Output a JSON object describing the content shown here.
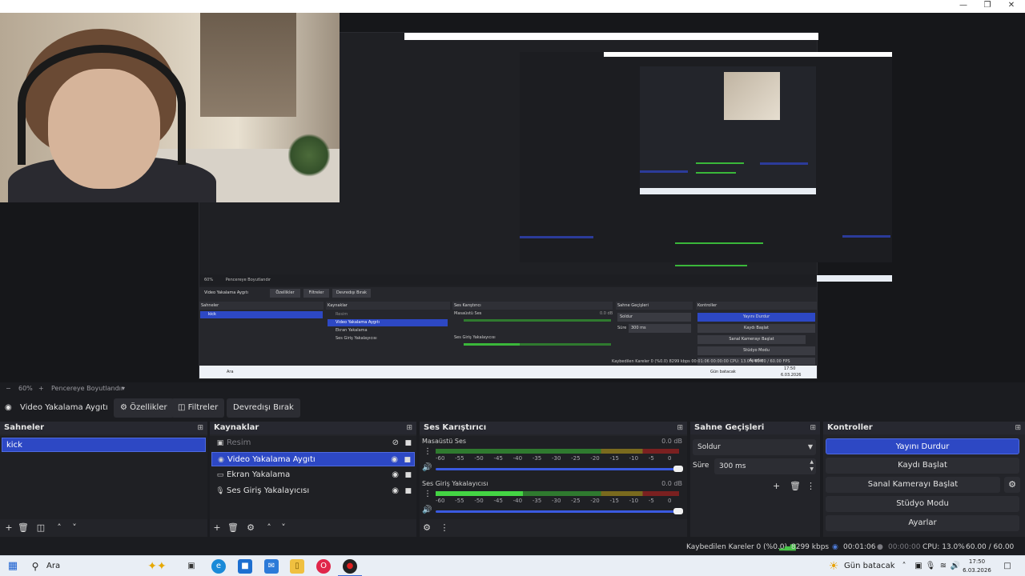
{
  "window": {
    "controls": [
      "—",
      "❐",
      "✕"
    ]
  },
  "nested_preview": {
    "zoom": "60%",
    "mode": "Pencereye Boyutlandır",
    "source_title": "Video Yakalama Aygıtı",
    "buttons": [
      "Özellikler",
      "Filtreler",
      "Devredışı Bırak"
    ],
    "scenes_header": "Sahneler",
    "scene": "kick",
    "sources_header": "Kaynaklar",
    "sources": [
      "Resim",
      "Video Yakalama Aygıtı",
      "Ekran Yakalama",
      "Ses Giriş Yakalayıcısı"
    ],
    "mixer_header": "Ses Karıştırıcı",
    "mixer_channels": [
      "Masaüstü Ses",
      "Ses Giriş Yakalayıcısı"
    ],
    "mixer_db": "0.0 dB",
    "transitions_header": "Sahne Geçişleri",
    "transition": "Soldur",
    "duration_label": "Süre",
    "duration": "300 ms",
    "controls_header": "Kontroller",
    "controls": [
      "Yayını Durdur",
      "Kaydı Başlat",
      "Sanal Kamerayı Başlat",
      "Stüdyo Modu",
      "Ayarlar"
    ],
    "status": "Kaybedilen Kareler 0 (%0.0)   8299 kbps   00:01:06   00:00:00   CPU: 13.0%   60.00 / 60.00 FPS",
    "search": "Ara",
    "weather": "Gün batacak",
    "time": "17:50",
    "date": "6.03.2026"
  },
  "zoom": {
    "minus": "−",
    "value": "60%",
    "plus": "+",
    "mode": "Pencereye Boyutlandır",
    "dropdown": "▾"
  },
  "source_bar": {
    "title": "Video Yakalama Aygıtı",
    "properties": "Özellikler",
    "filters": "Filtreler",
    "deactivate": "Devredışı Bırak"
  },
  "scenes": {
    "header": "Sahneler",
    "items": [
      "kick"
    ]
  },
  "sources": {
    "header": "Kaynaklar",
    "items": [
      {
        "label": "Resim",
        "icon": "image-icon",
        "visible": false
      },
      {
        "label": "Video Yakalama Aygıtı",
        "icon": "camera-icon",
        "visible": true
      },
      {
        "label": "Ekran Yakalama",
        "icon": "monitor-icon",
        "visible": true
      },
      {
        "label": "Ses Giriş Yakalayıcısı",
        "icon": "microphone-icon",
        "visible": true
      }
    ]
  },
  "mixer": {
    "header": "Ses Karıştırıcı",
    "ticks": [
      "-60",
      "-55",
      "-50",
      "-45",
      "-40",
      "-35",
      "-30",
      "-25",
      "-20",
      "-15",
      "-10",
      "-5",
      "0"
    ],
    "channels": [
      {
        "name": "Masaüstü Ses",
        "db": "0.0 dB",
        "level": 0.0
      },
      {
        "name": "Ses Giriş Yakalayıcısı",
        "db": "0.0 dB",
        "level": 0.36
      }
    ]
  },
  "transitions": {
    "header": "Sahne Geçişleri",
    "selected": "Soldur",
    "duration_label": "Süre",
    "duration": "300 ms"
  },
  "controls": {
    "header": "Kontroller",
    "stop_stream": "Yayını Durdur",
    "start_recording": "Kaydı Başlat",
    "start_virtual_cam": "Sanal Kamerayı Başlat",
    "studio_mode": "Stüdyo Modu",
    "settings": "Ayarlar"
  },
  "status": {
    "dropped_frames": "Kaybedilen Kareler 0 (%0.0)",
    "bitrate": "8299 kbps",
    "stream_time": "00:01:06",
    "rec_time": "00:00:00",
    "cpu": "CPU: 13.0%",
    "fps": "60.00 / 60.00 FPS"
  },
  "taskbar": {
    "search": "Ara",
    "weather": "Gün batacak",
    "time": "17:50",
    "date": "6.03.2026"
  },
  "colors": {
    "accent": "#2d48c4",
    "panel": "#232429",
    "background": "#1b1c20"
  }
}
